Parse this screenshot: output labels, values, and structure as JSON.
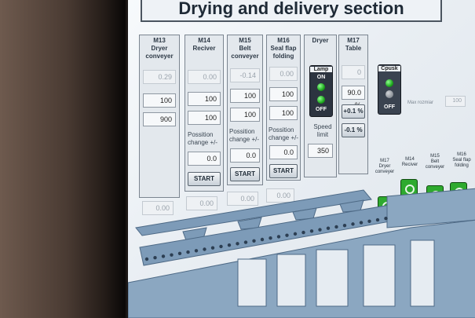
{
  "header": {
    "title": "Drying and delivery section"
  },
  "panels": [
    {
      "id": "m13",
      "line1": "M13",
      "line2": "Dryer",
      "line3": "conveyer",
      "f1": "0.29",
      "f2": "100",
      "f3": "900",
      "bottom": "0.00"
    },
    {
      "id": "m14",
      "line1": "M14",
      "line2": "Reciver",
      "line3": "",
      "f1": "0.00",
      "f2": "100",
      "f3": "100",
      "poslabel": "Possition change +/-",
      "pos": "0.0",
      "start": "START",
      "bottom": "0.00"
    },
    {
      "id": "m15",
      "line1": "M15",
      "line2": "Belt",
      "line3": "conveyer",
      "f1": "-0.14",
      "f2": "100",
      "f3": "100",
      "poslabel": "Possition change +/-",
      "pos": "0.0",
      "start": "START",
      "bottom": "0.00"
    },
    {
      "id": "m16",
      "line1": "M16",
      "line2": "Seal flap",
      "line3": "folding",
      "f1": "0.00",
      "f2": "100",
      "f3": "100",
      "poslabel": "Possition change +/-",
      "pos": "0.0",
      "start": "START",
      "bottom": "0.00"
    }
  ],
  "dryer": {
    "title": "Dryer",
    "lamp": "Lamp",
    "on": "ON",
    "off": "OFF",
    "speed_label": "Speed limit",
    "speed": "350"
  },
  "table": {
    "line1": "M17",
    "line2": "Table",
    "f1": "0",
    "f2": "90.0 %",
    "plus": "+0.1 %",
    "minus": "-0.1 %"
  },
  "cpusk": {
    "title": "Cpusk",
    "off": "OFF"
  },
  "max": {
    "label": "Max rozmiar",
    "value": "100"
  },
  "motors": [
    {
      "line1": "M17",
      "line2": "Dryer",
      "line3": "conveyer"
    },
    {
      "line1": "M14",
      "line2": "Reciver",
      "line3": ""
    },
    {
      "line1": "M15",
      "line2": "Belt",
      "line3": "conveyer"
    },
    {
      "line1": "M16",
      "line2": "Seal flap",
      "line3": "folding"
    }
  ],
  "colors": {
    "motor_on": "#2eaa2e",
    "machine": "#7d9bb8",
    "screen": "#eef2f6"
  }
}
